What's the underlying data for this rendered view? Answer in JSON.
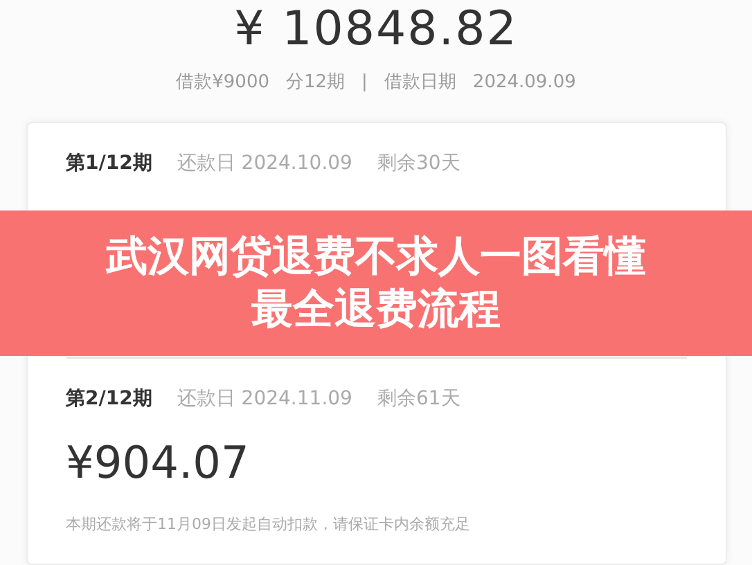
{
  "total_amount": "¥ 10848.82",
  "loan_info": {
    "principal": "借款¥9000",
    "installments": "分12期",
    "separator": "|",
    "date_label": "借款日期",
    "date": "2024.09.09"
  },
  "periods": [
    {
      "period": "第1/12期",
      "due_label": "还款日 2024.10.09",
      "remaining": "剩余30天"
    },
    {
      "period": "第2/12期",
      "due_label": "还款日 2024.11.09",
      "remaining": "剩余61天",
      "amount": "¥904.07",
      "note": "本期还款将于11月09日发起自动扣款，请保证卡内余额充足"
    }
  ],
  "banner": {
    "lines": [
      "武汉网贷退费不求人一图看懂",
      "最全退费流程"
    ]
  }
}
